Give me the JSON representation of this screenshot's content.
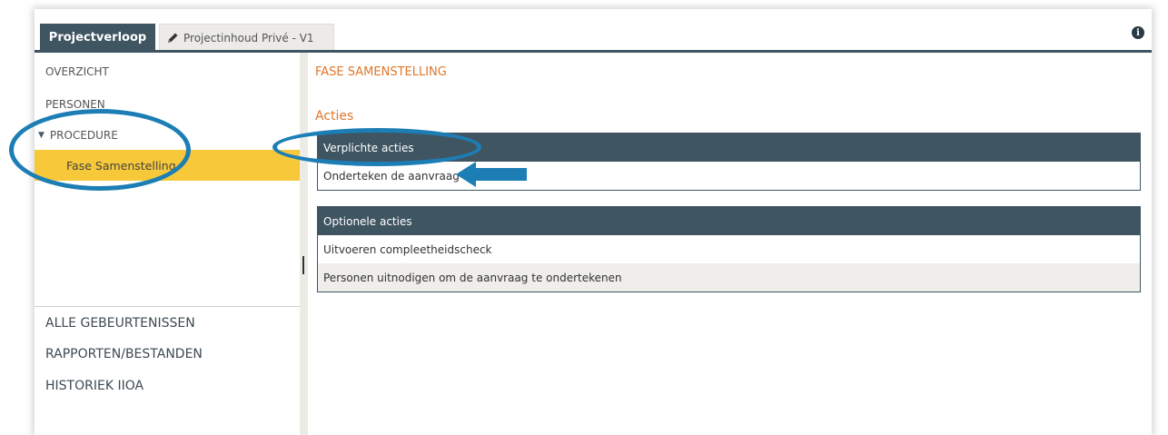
{
  "tabs": {
    "active_label": "Projectverloop",
    "inactive_label": "Projectinhoud Privé - V1",
    "inactive_icon": "pencil-icon"
  },
  "header": {
    "info_icon": "info-icon",
    "info_glyph": "i"
  },
  "sidebar": {
    "overzicht": "OVERZICHT",
    "personen": "PERSONEN",
    "procedure": "PROCEDURE",
    "procedure_caret": "▼",
    "fase": "Fase Samenstelling",
    "alle": "ALLE GEBEURTENISSEN",
    "rapporten": "RAPPORTEN/BESTANDEN",
    "historiek": "HISTORIEK IIOA"
  },
  "main": {
    "phase_title": "FASE SAMENSTELLING",
    "acties_title": "Acties",
    "verplicht": {
      "header": "Verplichte acties",
      "rows": [
        "Onderteken de aanvraag"
      ]
    },
    "optioneel": {
      "header": "Optionele acties",
      "rows": [
        "Uitvoeren compleetheidscheck",
        "Personen uitnodigen om de aanvraag te ondertekenen"
      ]
    }
  },
  "colors": {
    "tab_active_bg": "#3f5562",
    "highlight": "#f6c83a",
    "accent_orange": "#e0762b",
    "annotation_blue": "#1d7eb5"
  }
}
